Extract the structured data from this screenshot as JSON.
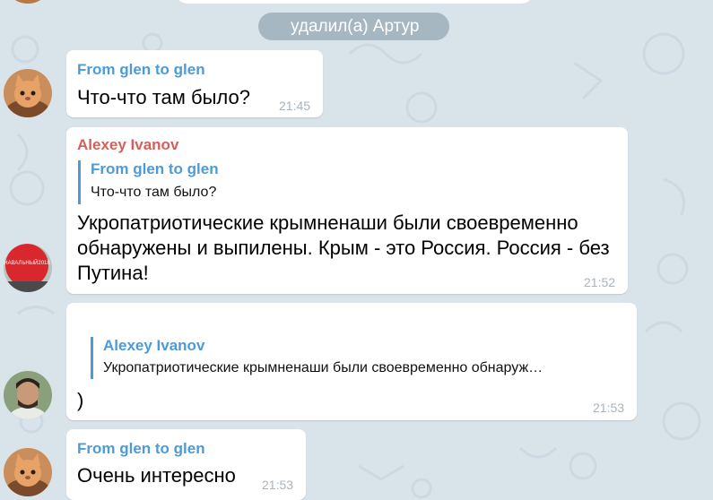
{
  "service_message": "удалил(а) Артур",
  "messages": [
    {
      "sender": "From glen to glen",
      "text": "Что-что там было?",
      "time": "21:45"
    },
    {
      "sender": "Alexey Ivanov",
      "reply": {
        "name": "From glen to glen",
        "text": "Что-что там было?"
      },
      "text": "Укропатриотические крымненаши были своевременно обнаружены и выпилены. Крым - это Россия. Россия - без Путина!",
      "time": "21:52"
    },
    {
      "reply": {
        "name": "Alexey Ivanov",
        "text": "Укропатриотические крымненаши были своевременно обнаруж…"
      },
      "text": ")",
      "time": "21:53"
    },
    {
      "sender": "From glen to glen",
      "text": "Очень интересно",
      "time": "21:53"
    }
  ],
  "avatar_badge": "НАВАЛЬНЫЙ2018",
  "colors": {
    "background": "#d8e3ea",
    "link": "#4d9bd6",
    "sender_red": "#d3605a",
    "time": "#a9b4bd"
  },
  "icons": [
    "cat-avatar-icon",
    "red-balloon-avatar-icon",
    "man-avatar-icon"
  ]
}
